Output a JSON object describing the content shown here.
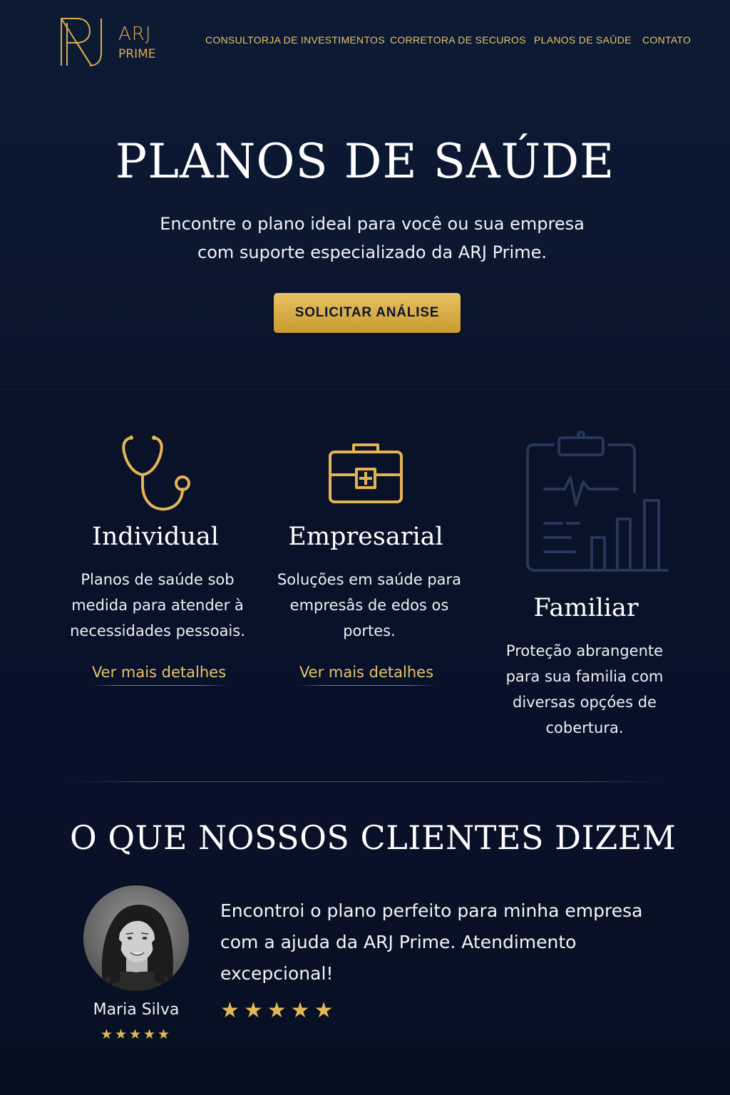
{
  "brand": {
    "name_line1": "ARJ",
    "name_line2": "PRIME",
    "logo_icon": "arj-monogram-icon",
    "accent_color": "#d6ad4f"
  },
  "nav": {
    "items": [
      {
        "label": "CONSULTORJA DE INVESTIMENTOS"
      },
      {
        "label": "CORRETORA DE SECUROS"
      },
      {
        "label": "PLANOS DE SAŪDE"
      },
      {
        "label": "CONTATO"
      }
    ]
  },
  "hero": {
    "title": "PLANOS DE SAÚDE",
    "subtitle": "Encontre o plano ideal para você ou sua empresa com suporte especializado da ARJ Prime.",
    "cta_label": "SOLICITAR ANÁLISE"
  },
  "plans": [
    {
      "icon": "stethoscope-icon",
      "title": "Individual",
      "description": "Planos de saúde sob medida para atender à necessidades pessoais.",
      "link_label": "Ver mais detalhes"
    },
    {
      "icon": "medical-briefcase-icon",
      "title": "Empresarial",
      "description": "Soluções em saúde para empresâs de edos os portes.",
      "link_label": "Ver mais detalhes"
    },
    {
      "icon": "clipboard-chart-icon",
      "title": "Familiar",
      "description": "Proteção abrangente para sua familia com diversas opçóes de cobertura."
    }
  ],
  "testimonials": {
    "title": "O QUE NOSSOS CLIENTES DIZEM",
    "items": [
      {
        "avatar_icon": "client-portrait",
        "name": "Maria Silva",
        "rating": 5,
        "rating_stars": "★★★★★",
        "quote": "Encontroi o plano perfeito para minha empresa com a ajuda da ARJ Prime. Atendimento excepcional!"
      }
    ]
  },
  "colors": {
    "background": "#0a1328",
    "gold": "#e7c36a",
    "button_gold": "#d4aa45",
    "icon_muted": "#2a3a5c"
  }
}
